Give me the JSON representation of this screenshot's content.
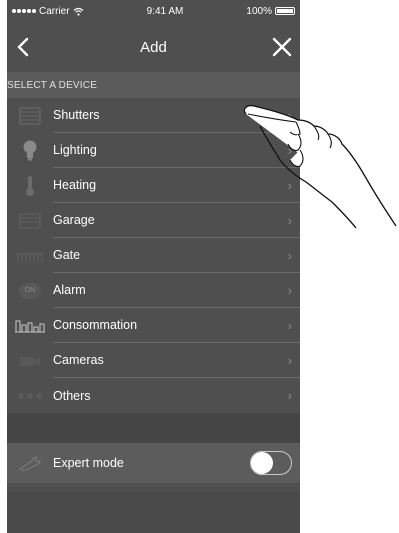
{
  "status_bar": {
    "carrier": "Carrier",
    "time": "9:41 AM",
    "battery": "100%"
  },
  "nav": {
    "title": "Add",
    "back_icon": "chevron-left-icon",
    "close_icon": "close-icon"
  },
  "section": {
    "header": "SELECT A DEVICE"
  },
  "devices": [
    {
      "label": "Shutters",
      "icon": "shutter-icon"
    },
    {
      "label": "Lighting",
      "icon": "bulb-icon"
    },
    {
      "label": "Heating",
      "icon": "thermometer-icon"
    },
    {
      "label": "Garage",
      "icon": "garage-icon"
    },
    {
      "label": "Gate",
      "icon": "gate-icon"
    },
    {
      "label": "Alarm",
      "icon_text": "ON",
      "icon": "alarm-on-icon"
    },
    {
      "label": "Consommation",
      "icon": "bar-chart-icon"
    },
    {
      "label": "Cameras",
      "icon": "camera-icon"
    },
    {
      "label": "Others",
      "icon": "others-icon"
    }
  ],
  "expert_mode": {
    "label": "Expert mode",
    "enabled": false,
    "icon": "wrench-icon"
  },
  "colors": {
    "background": "#4f4f4f",
    "section_header": "#5b5b5b",
    "text": "#ffffff"
  }
}
